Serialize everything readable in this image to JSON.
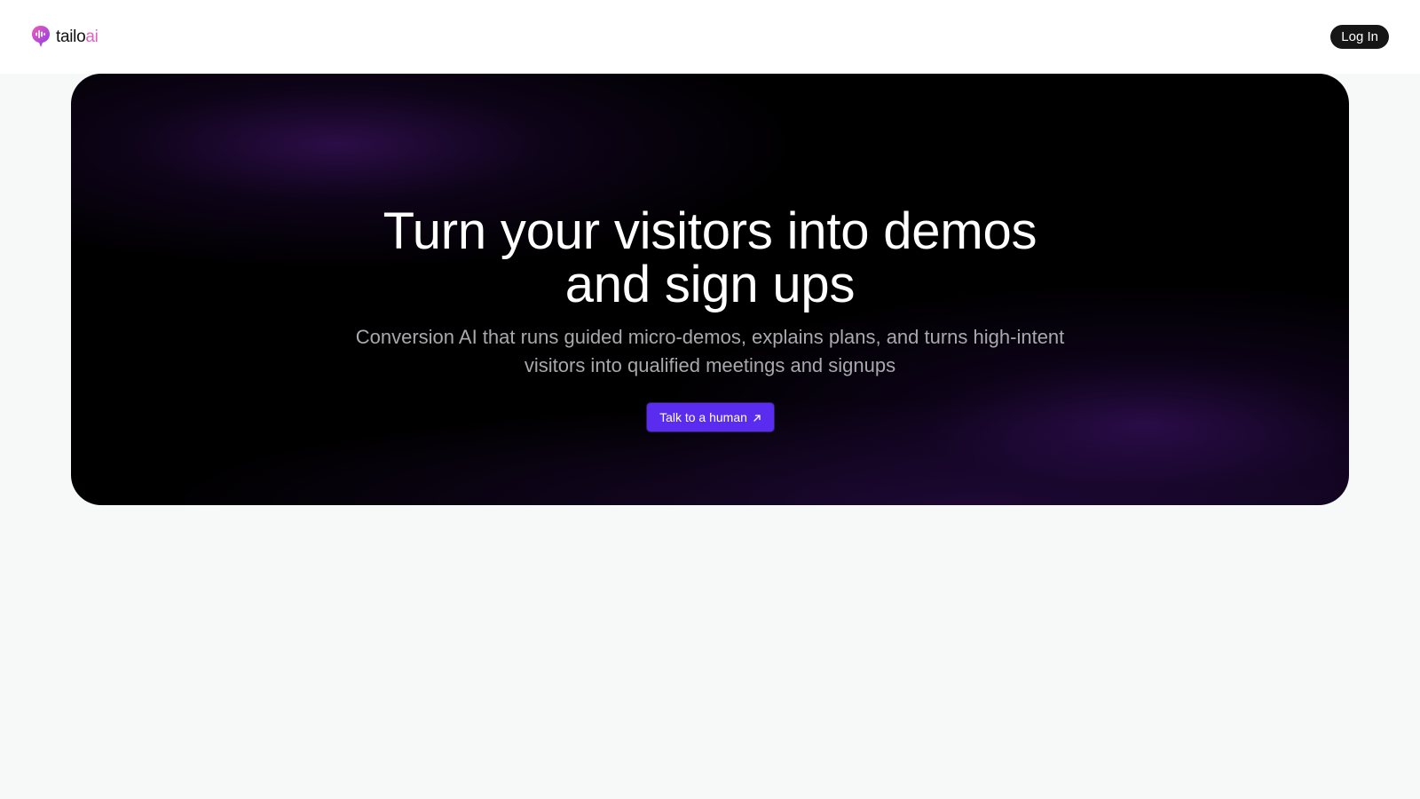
{
  "header": {
    "logo": {
      "name_part1": "tailo",
      "name_part2": "ai",
      "icon": "chat-bubble-waveform-icon",
      "colors": {
        "gradient_start": "#f05ab5",
        "gradient_end": "#8a3cf0",
        "text": "#111111",
        "accent_text": "#e260c9"
      }
    },
    "login_label": "Log In"
  },
  "hero": {
    "title_line1": "Turn your visitors into demos",
    "title_line2": "and sign ups",
    "subtitle_line1": "Conversion AI that runs guided micro-demos, explains plans, and turns high-intent",
    "subtitle_line2": "visitors into qualified meetings and signups",
    "cta": {
      "label": "Talk to a human",
      "icon": "arrow-up-right-icon",
      "color": "#5a2cf0"
    },
    "colors": {
      "background": "#000000",
      "glow": "#4e1880"
    }
  },
  "page": {
    "background": "#f7f8f8"
  }
}
